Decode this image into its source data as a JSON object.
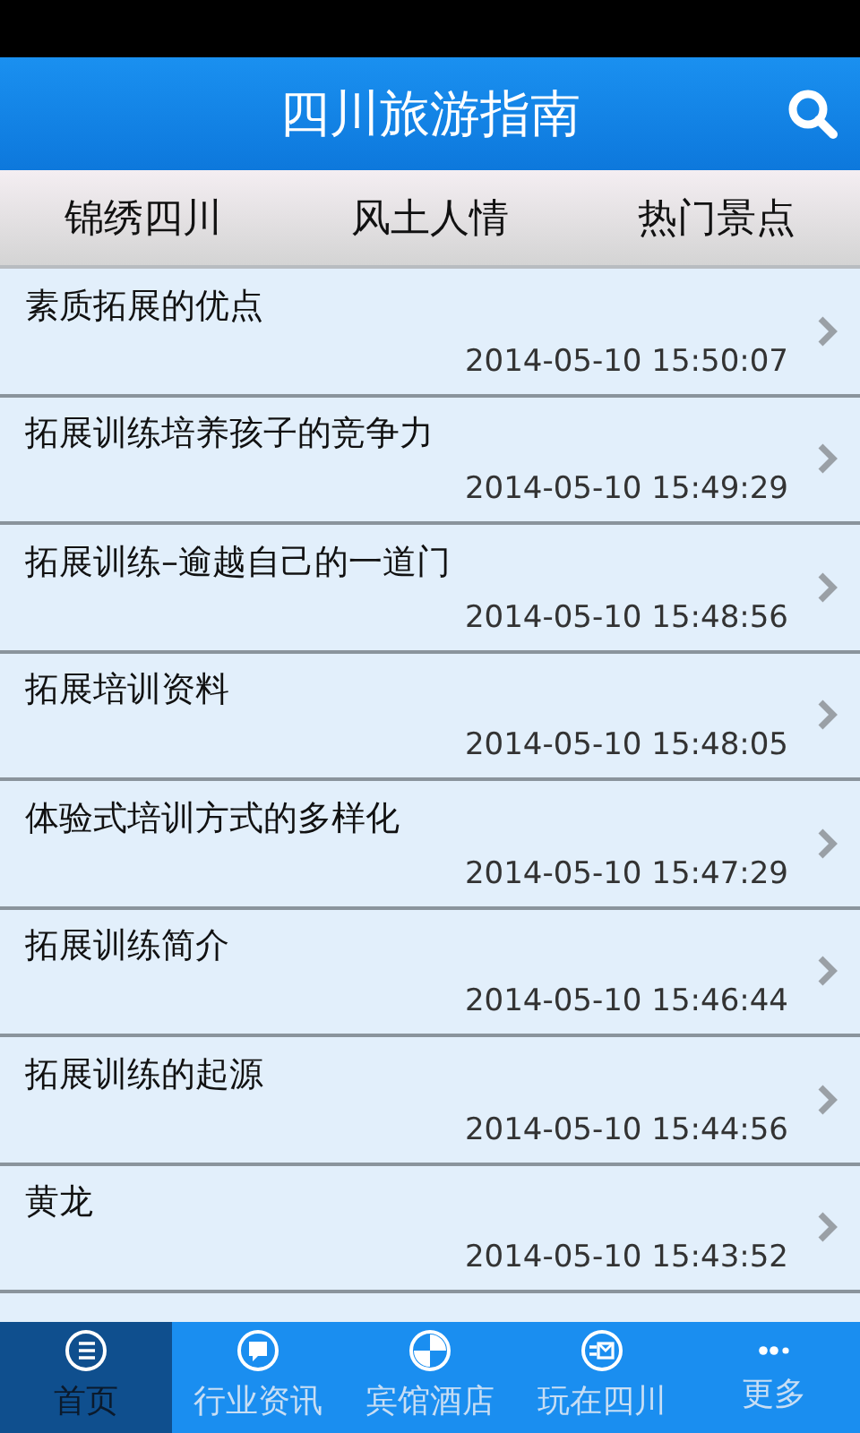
{
  "header": {
    "title": "四川旅游指南"
  },
  "tabs": [
    {
      "label": "锦绣四川"
    },
    {
      "label": "风土人情"
    },
    {
      "label": "热门景点"
    }
  ],
  "articles": [
    {
      "title": "素质拓展的优点",
      "time": "2014-05-10 15:50:07"
    },
    {
      "title": "拓展训练培养孩子的竞争力",
      "time": "2014-05-10 15:49:29"
    },
    {
      "title": "拓展训练–逾越自己的一道门",
      "time": "2014-05-10 15:48:56"
    },
    {
      "title": "拓展培训资料",
      "time": "2014-05-10 15:48:05"
    },
    {
      "title": "体验式培训方式的多样化",
      "time": "2014-05-10 15:47:29"
    },
    {
      "title": "拓展训练简介",
      "time": "2014-05-10 15:46:44"
    },
    {
      "title": "拓展训练的起源",
      "time": "2014-05-10 15:44:56"
    },
    {
      "title": "黄龙",
      "time": "2014-05-10 15:43:52"
    }
  ],
  "bottom_nav": [
    {
      "label": "首页",
      "kind": "list",
      "selected": true
    },
    {
      "label": "行业资讯",
      "kind": "chat",
      "selected": false
    },
    {
      "label": "宾馆酒店",
      "kind": "ball",
      "selected": false
    },
    {
      "label": "玩在四川",
      "kind": "mail",
      "selected": false
    },
    {
      "label": "更多",
      "kind": "dots",
      "selected": false
    }
  ]
}
